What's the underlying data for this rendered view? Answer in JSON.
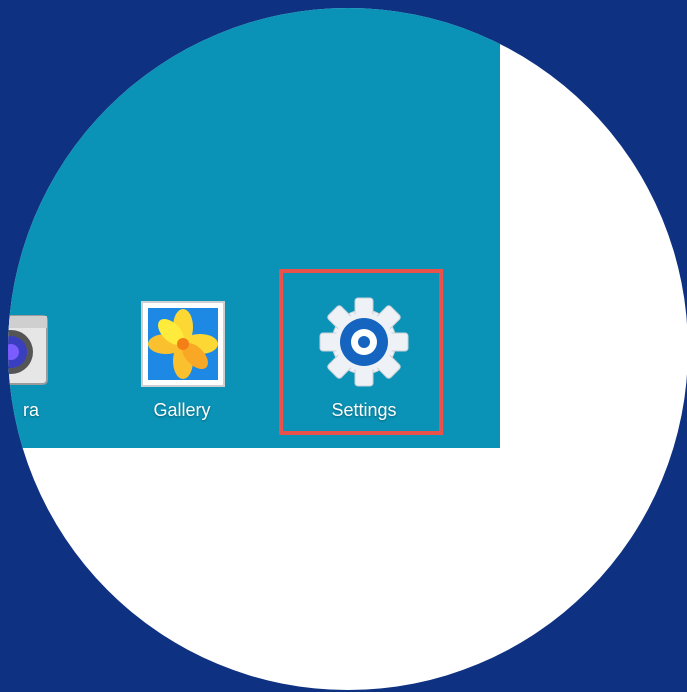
{
  "apps": [
    {
      "name": "camera",
      "label": "ra"
    },
    {
      "name": "gallery",
      "label": "Gallery"
    },
    {
      "name": "settings",
      "label": "Settings"
    }
  ],
  "colors": {
    "background": "#0e3182",
    "homescreen": "#0a93b6",
    "highlight": "#e8524a",
    "settings_icon": "#1565c0"
  },
  "icons": [
    "camera-icon",
    "gallery-icon",
    "settings-gear-icon"
  ]
}
